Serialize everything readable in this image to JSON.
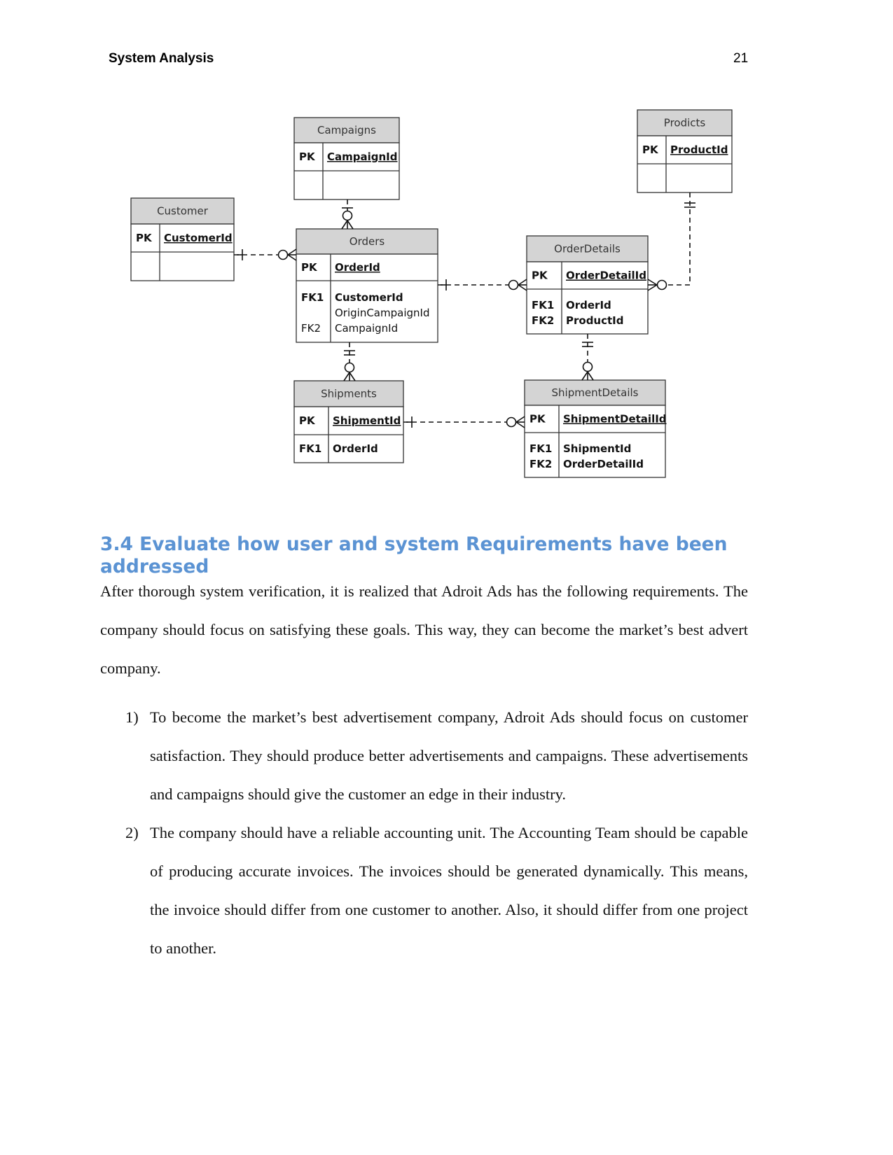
{
  "header": {
    "running_head": "System Analysis",
    "page_number": "21"
  },
  "diagram": {
    "tables": [
      {
        "name": "Campaigns",
        "pk_label": "PK",
        "pk_field": "CampaignId",
        "fk_rows": []
      },
      {
        "name": "Prodicts",
        "pk_label": "PK",
        "pk_field": "ProductId",
        "fk_rows": []
      },
      {
        "name": "Customer",
        "pk_label": "PK",
        "pk_field": "CustomerId",
        "fk_rows": []
      },
      {
        "name": "Orders",
        "pk_label": "PK",
        "pk_field": "OrderId",
        "fk_rows": [
          {
            "label": "FK1",
            "field": "CustomerId",
            "bold": true
          },
          {
            "label": "",
            "field": "OriginCampaignId",
            "bold": false
          },
          {
            "label": "FK2",
            "field": "CampaignId",
            "bold": false
          }
        ]
      },
      {
        "name": "OrderDetails",
        "pk_label": "PK",
        "pk_field": "OrderDetailId",
        "fk_rows": [
          {
            "label": "FK1",
            "field": "OrderId",
            "bold": true
          },
          {
            "label": "FK2",
            "field": "ProductId",
            "bold": true
          }
        ]
      },
      {
        "name": "Shipments",
        "pk_label": "PK",
        "pk_field": "ShipmentId",
        "fk_rows": [
          {
            "label": "FK1",
            "field": "OrderId",
            "bold": true
          }
        ]
      },
      {
        "name": "ShipmentDetails",
        "pk_label": "PK",
        "pk_field": "ShipmentDetailId",
        "fk_rows": [
          {
            "label": "FK1",
            "field": "ShipmentId",
            "bold": true
          },
          {
            "label": "FK2",
            "field": "OrderDetailId",
            "bold": true
          }
        ]
      }
    ],
    "relationships": [
      {
        "from": "Customer",
        "to": "Orders",
        "type": "one-to-zero-or-many"
      },
      {
        "from": "Campaigns",
        "to": "Orders",
        "type": "zero-or-one-to-zero-or-many"
      },
      {
        "from": "Orders",
        "to": "OrderDetails",
        "type": "one-to-zero-or-many"
      },
      {
        "from": "Prodicts",
        "to": "OrderDetails",
        "type": "one-to-zero-or-many"
      },
      {
        "from": "Orders",
        "to": "Shipments",
        "type": "one-to-zero-or-many"
      },
      {
        "from": "OrderDetails",
        "to": "ShipmentDetails",
        "type": "one-to-zero-or-many"
      },
      {
        "from": "Shipments",
        "to": "ShipmentDetails",
        "type": "one-to-zero-or-many"
      }
    ],
    "colors": {
      "header_fill": "#d4d4d4",
      "border": "#333333"
    }
  },
  "section": {
    "heading": "3.4 Evaluate how user and system Requirements have been addressed",
    "heading_color": "#5b93d3",
    "intro": "After thorough system verification, it is realized that Adroit Ads has the following requirements. The company should focus on satisfying these goals. This way, they can become the market’s best advert company.",
    "items": [
      {
        "num": "1)",
        "text": "To become the market’s best advertisement company, Adroit Ads should focus on customer satisfaction. They should produce better advertisements and campaigns. These advertisements and campaigns should give the customer an edge in their industry."
      },
      {
        "num": "2)",
        "text": "The company should have a reliable accounting unit. The Accounting Team should be capable of producing accurate invoices. The invoices should be generated dynamically. This means, the invoice should differ from one customer to another. Also, it should differ from one project to another."
      }
    ]
  }
}
